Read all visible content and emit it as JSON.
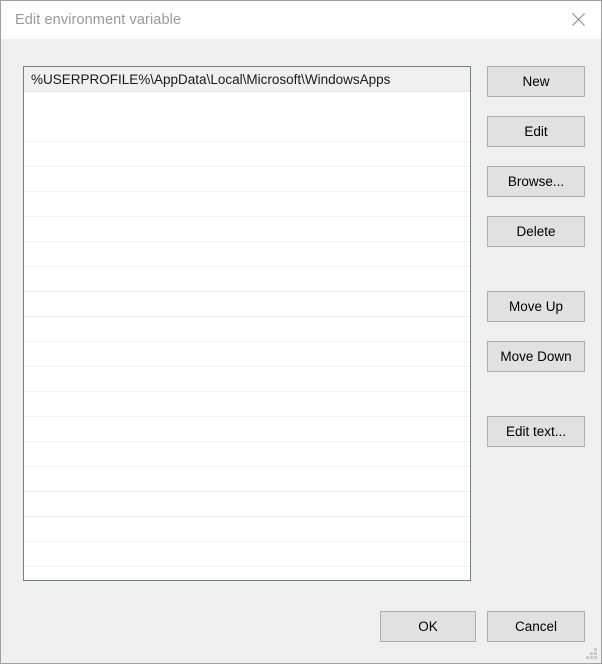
{
  "window": {
    "title": "Edit environment variable",
    "close_icon": "close-icon",
    "resize_grip_icon": "resize-grip-icon",
    "background_color": "#f0f0f0",
    "titlebar_color": "#ffffff",
    "title_text_color": "#9a9a9a"
  },
  "paths_list": {
    "entries": [
      "%USERPROFILE%\\AppData\\Local\\Microsoft\\WindowsApps"
    ],
    "empty_row_count": 19,
    "selected_index": 0,
    "border_color": "#7a7f87",
    "row_background": "#ffffff",
    "selected_row_background": "#f0f0f0"
  },
  "side_buttons": [
    {
      "id": "new",
      "label": "New"
    },
    {
      "id": "edit",
      "label": "Edit"
    },
    {
      "id": "browse",
      "label": "Browse..."
    },
    {
      "id": "delete",
      "label": "Delete"
    },
    {
      "id": "move_up",
      "label": "Move Up"
    },
    {
      "id": "move_down",
      "label": "Move Down"
    },
    {
      "id": "edit_text",
      "label": "Edit text..."
    }
  ],
  "footer_buttons": [
    {
      "id": "ok",
      "label": "OK"
    },
    {
      "id": "cancel",
      "label": "Cancel"
    }
  ],
  "colors": {
    "button_face": "#e1e1e1",
    "button_border": "#adadad",
    "row_separator": "#f1f1f1"
  }
}
